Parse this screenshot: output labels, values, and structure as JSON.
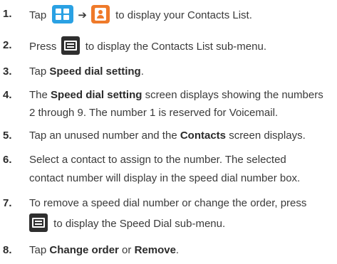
{
  "icons": [
    "apps-grid-icon",
    "contacts-icon",
    "menu-key-icon"
  ],
  "colors": {
    "apps_icon": "#2aa1e3",
    "contacts_icon": "#ef7a2a",
    "menu_icon": "#2f2f2f"
  },
  "steps": [
    {
      "number": "1.",
      "pre": "Tap",
      "arrow": "➔",
      "post": "to display your Contacts List."
    },
    {
      "number": "2.",
      "pre": "Press",
      "post": "to display the Contacts List sub-menu."
    },
    {
      "number": "3.",
      "pre": "Tap",
      "bold": "Speed dial setting",
      "post": "."
    },
    {
      "number": "4.",
      "pre": "The",
      "bold": "Speed dial setting",
      "post": "screen displays showing the numbers",
      "line2": "2 through 9. The number 1 is reserved for Voicemail."
    },
    {
      "number": "5.",
      "pre": "Tap an unused number and the",
      "bold": "Contacts",
      "post": "screen displays."
    },
    {
      "number": "6.",
      "line1": "Select a contact to assign to the number. The selected",
      "line2": "contact number will display in the speed dial number box."
    },
    {
      "number": "7.",
      "line1": "To remove a speed dial number or change the order, press",
      "line2_post": "to display the Speed Dial sub-menu."
    },
    {
      "number": "8.",
      "pre": "Tap",
      "bold1": "Change order",
      "mid": "or",
      "bold2": "Remove",
      "post": "."
    }
  ]
}
